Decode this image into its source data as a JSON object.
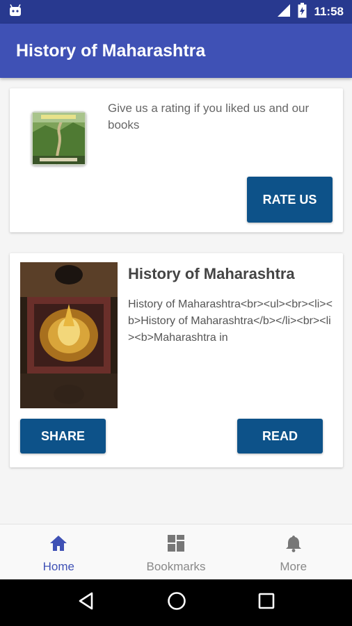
{
  "status_bar": {
    "time": "11:58",
    "left_icon": "android-debug-icon",
    "signal_icon": "signal-icon",
    "battery_icon": "battery-charging-icon"
  },
  "app_bar": {
    "title": "History of Maharashtra"
  },
  "rate_card": {
    "text": "Give us a rating if you liked us and our books",
    "button_label": "RATE US",
    "thumbnail_icon": "book-cover-thumbnail"
  },
  "book_card": {
    "title": "History of Maharashtra",
    "description": "History of Maharashtra<br><ul><br><li><b>History of Maharashtra</b></li><br><li><b>Maharashtra in",
    "share_label": "SHARE",
    "read_label": "READ",
    "image_icon": "book-cover-image"
  },
  "bottom_nav": {
    "items": [
      {
        "label": "Home",
        "icon": "home-icon",
        "active": true
      },
      {
        "label": "Bookmarks",
        "icon": "bookmarks-icon",
        "active": false
      },
      {
        "label": "More",
        "icon": "bell-icon",
        "active": false
      }
    ]
  },
  "colors": {
    "status_bar": "#28398f",
    "app_bar": "#3f51b5",
    "button": "#0d5289",
    "active_nav": "#3f51b5"
  }
}
